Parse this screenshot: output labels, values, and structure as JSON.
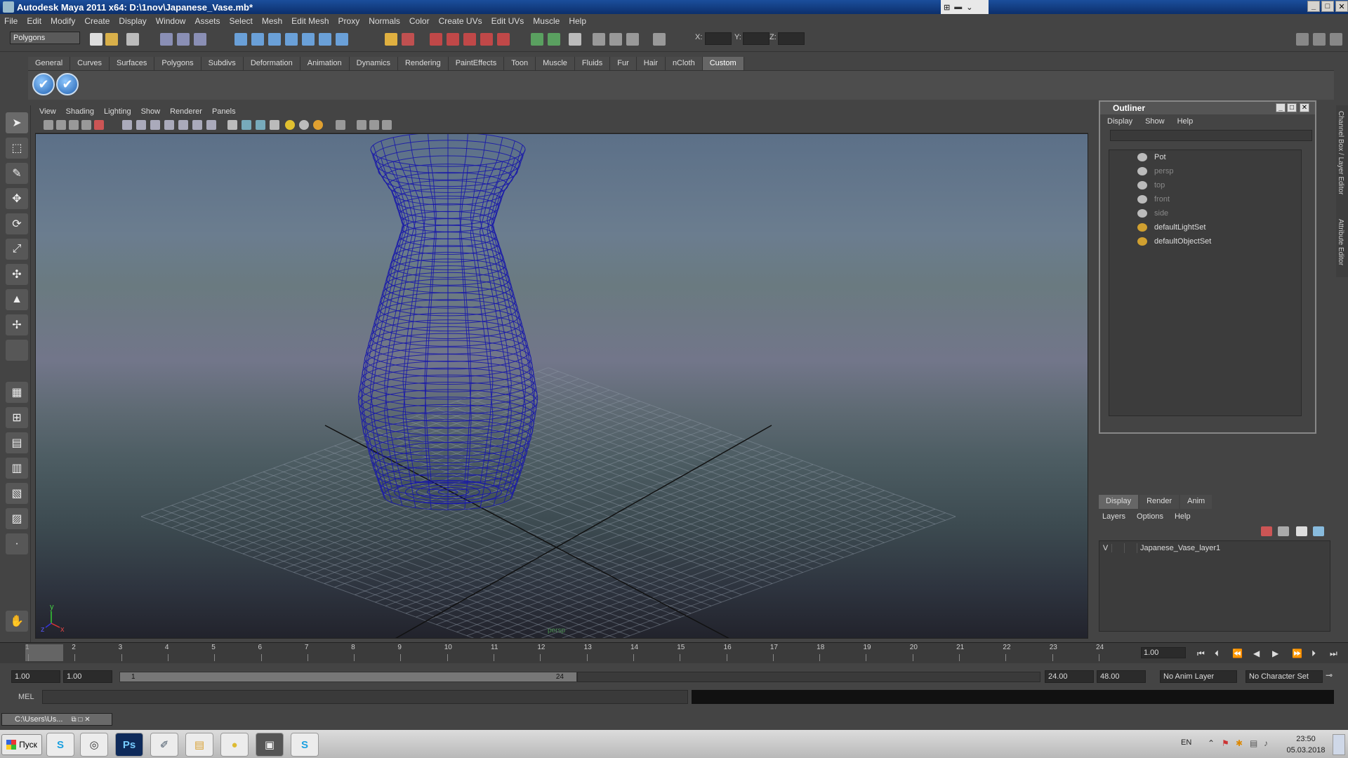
{
  "window": {
    "title": "Autodesk Maya 2011 x64: D:\\1nov\\Japanese_Vase.mb*"
  },
  "menus": [
    "File",
    "Edit",
    "Modify",
    "Create",
    "Display",
    "Window",
    "Assets",
    "Select",
    "Mesh",
    "Edit Mesh",
    "Proxy",
    "Normals",
    "Color",
    "Create UVs",
    "Edit UVs",
    "Muscle",
    "Help"
  ],
  "status_line": {
    "mode": "Polygons",
    "x_label": "X:",
    "y_label": "Y:",
    "z_label": "Z:"
  },
  "shelf": {
    "tabs": [
      "General",
      "Curves",
      "Surfaces",
      "Polygons",
      "Subdivs",
      "Deformation",
      "Animation",
      "Dynamics",
      "Rendering",
      "PaintEffects",
      "Toon",
      "Muscle",
      "Fluids",
      "Fur",
      "Hair",
      "nCloth",
      "Custom"
    ],
    "active_tab": "Custom"
  },
  "viewport": {
    "menus": [
      "View",
      "Shading",
      "Lighting",
      "Show",
      "Renderer",
      "Panels"
    ],
    "camera_label": "persp",
    "axis_x": "x",
    "axis_y": "y",
    "axis_z": "z",
    "wire_color": "#1a1aa8"
  },
  "outliner": {
    "title": "Outliner",
    "menus": [
      "Display",
      "Show",
      "Help"
    ],
    "items": [
      {
        "label": "Pot",
        "dim": false
      },
      {
        "label": "persp",
        "dim": true
      },
      {
        "label": "top",
        "dim": true
      },
      {
        "label": "front",
        "dim": true
      },
      {
        "label": "side",
        "dim": true
      },
      {
        "label": "defaultLightSet",
        "dim": false
      },
      {
        "label": "defaultObjectSet",
        "dim": false
      }
    ]
  },
  "layer_editor": {
    "tabs": [
      "Display",
      "Render",
      "Anim"
    ],
    "active_tab": "Display",
    "menus": [
      "Layers",
      "Options",
      "Help"
    ],
    "layers": [
      {
        "visible": "V",
        "name": "Japanese_Vase_layer1"
      }
    ]
  },
  "side_tabs": [
    "Channel Box / Layer Editor",
    "Attribute Editor"
  ],
  "time_slider": {
    "frames": [
      "1",
      "2",
      "3",
      "4",
      "5",
      "6",
      "7",
      "8",
      "9",
      "10",
      "11",
      "12",
      "13",
      "14",
      "15",
      "16",
      "17",
      "18",
      "19",
      "20",
      "21",
      "22",
      "23",
      "24"
    ],
    "current_frame": "1.00"
  },
  "range_slider": {
    "start_time": "1.00",
    "playback_start": "1.00",
    "range_start": "1",
    "range_end": "24",
    "playback_end": "24.00",
    "end_time": "48.00",
    "anim_layer": "No Anim Layer",
    "character_set": "No Character Set"
  },
  "command_line": {
    "label": "MEL"
  },
  "minimized_window": {
    "title": "C:\\Users\\Us..."
  },
  "taskbar": {
    "start_label": "Пуск",
    "apps": [
      "S",
      "◎",
      "Ps",
      "✐",
      "▤",
      "●",
      "▣",
      "S"
    ],
    "language": "EN",
    "time": "23:50",
    "date": "05.03.2018"
  }
}
